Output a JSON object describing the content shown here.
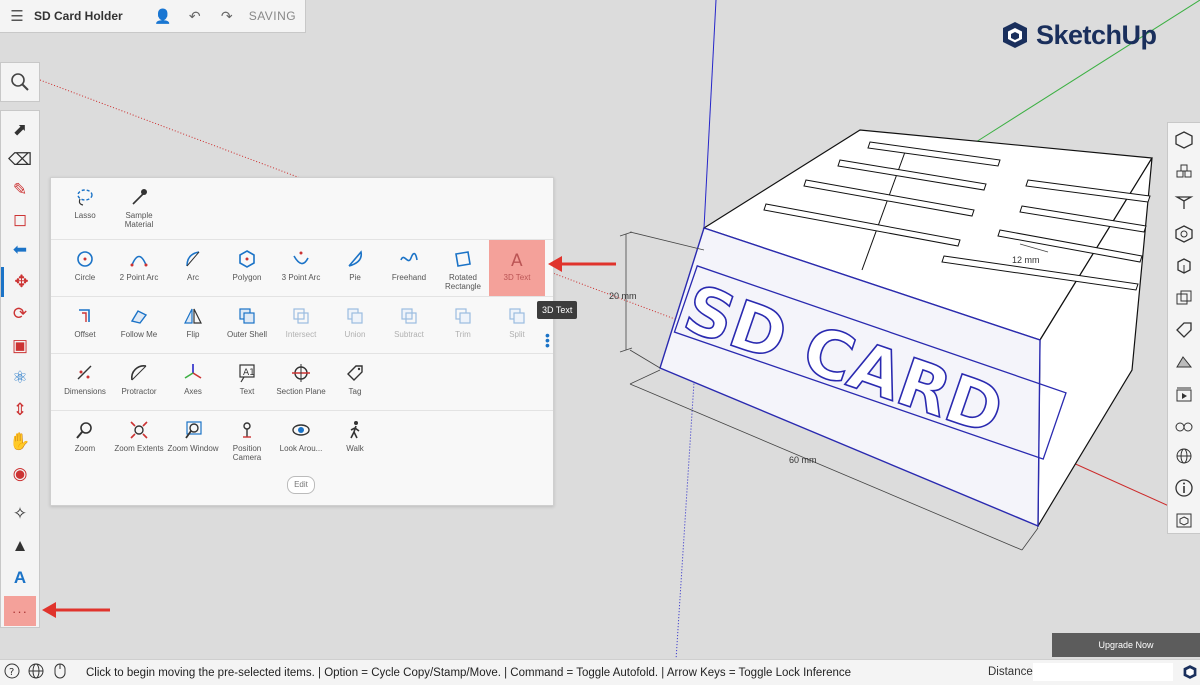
{
  "title_bar": {
    "menu_icon": "hamburger-icon",
    "document_title": "SD Card Holder",
    "status_text": "SAVING"
  },
  "logo": {
    "name": "SketchUp"
  },
  "colors": {
    "highlight": "#f4a19a",
    "accent_blue": "#1b73c7",
    "arrow_red": "#e0332c",
    "sketchup_navy": "#1a2f5c",
    "model_outline": "#2a2ab0"
  },
  "panel": {
    "rows": [
      [
        {
          "label": "Lasso",
          "icon": "lasso-icon"
        },
        {
          "label": "Sample Material",
          "icon": "eyedropper-icon"
        }
      ],
      [
        {
          "label": "Circle",
          "icon": "circle-icon"
        },
        {
          "label": "2 Point Arc",
          "icon": "2-point-arc-icon"
        },
        {
          "label": "Arc",
          "icon": "arc-icon"
        },
        {
          "label": "Polygon",
          "icon": "polygon-icon"
        },
        {
          "label": "3 Point Arc",
          "icon": "3-point-arc-icon"
        },
        {
          "label": "Pie",
          "icon": "pie-icon"
        },
        {
          "label": "Freehand",
          "icon": "freehand-icon"
        },
        {
          "label": "Rotated Rectangle",
          "icon": "rotated-rectangle-icon"
        },
        {
          "label": "3D Text",
          "icon": "3d-text-icon"
        }
      ],
      [
        {
          "label": "Offset",
          "icon": "offset-icon"
        },
        {
          "label": "Follow Me",
          "icon": "follow-me-icon"
        },
        {
          "label": "Flip",
          "icon": "flip-icon"
        },
        {
          "label": "Outer Shell",
          "icon": "outer-shell-icon"
        },
        {
          "label": "Intersect",
          "icon": "intersect-icon"
        },
        {
          "label": "Union",
          "icon": "union-icon"
        },
        {
          "label": "Subtract",
          "icon": "subtract-icon"
        },
        {
          "label": "Trim",
          "icon": "trim-icon"
        },
        {
          "label": "Split",
          "icon": "split-icon"
        }
      ],
      [
        {
          "label": "Dimensions",
          "icon": "dimensions-icon"
        },
        {
          "label": "Protractor",
          "icon": "protractor-icon"
        },
        {
          "label": "Axes",
          "icon": "axes-icon"
        },
        {
          "label": "Text",
          "icon": "text-icon"
        },
        {
          "label": "Section Plane",
          "icon": "section-plane-icon"
        },
        {
          "label": "Tag",
          "icon": "tag-icon"
        }
      ],
      [
        {
          "label": "Zoom",
          "icon": "zoom-icon"
        },
        {
          "label": "Zoom Extents",
          "icon": "zoom-extents-icon"
        },
        {
          "label": "Zoom Window",
          "icon": "zoom-window-icon"
        },
        {
          "label": "Position Camera",
          "icon": "position-camera-icon"
        },
        {
          "label": "Look Arou...",
          "icon": "look-around-icon"
        },
        {
          "label": "Walk",
          "icon": "walk-icon"
        }
      ]
    ],
    "edit_label": "Edit",
    "tooltip": "3D Text"
  },
  "model": {
    "text": "SD CARD",
    "dimensions": {
      "height": "20 mm",
      "width": "60 mm",
      "slot": "12 mm"
    }
  },
  "upgrade_label": "Upgrade Now",
  "status_bar": {
    "message": "Click to begin moving the pre-selected items. | Option = Cycle Copy/Stamp/Move. | Command = Toggle Autofold. | Arrow Keys = Toggle Lock Inference",
    "distance_label": "Distance",
    "distance_value": ""
  }
}
